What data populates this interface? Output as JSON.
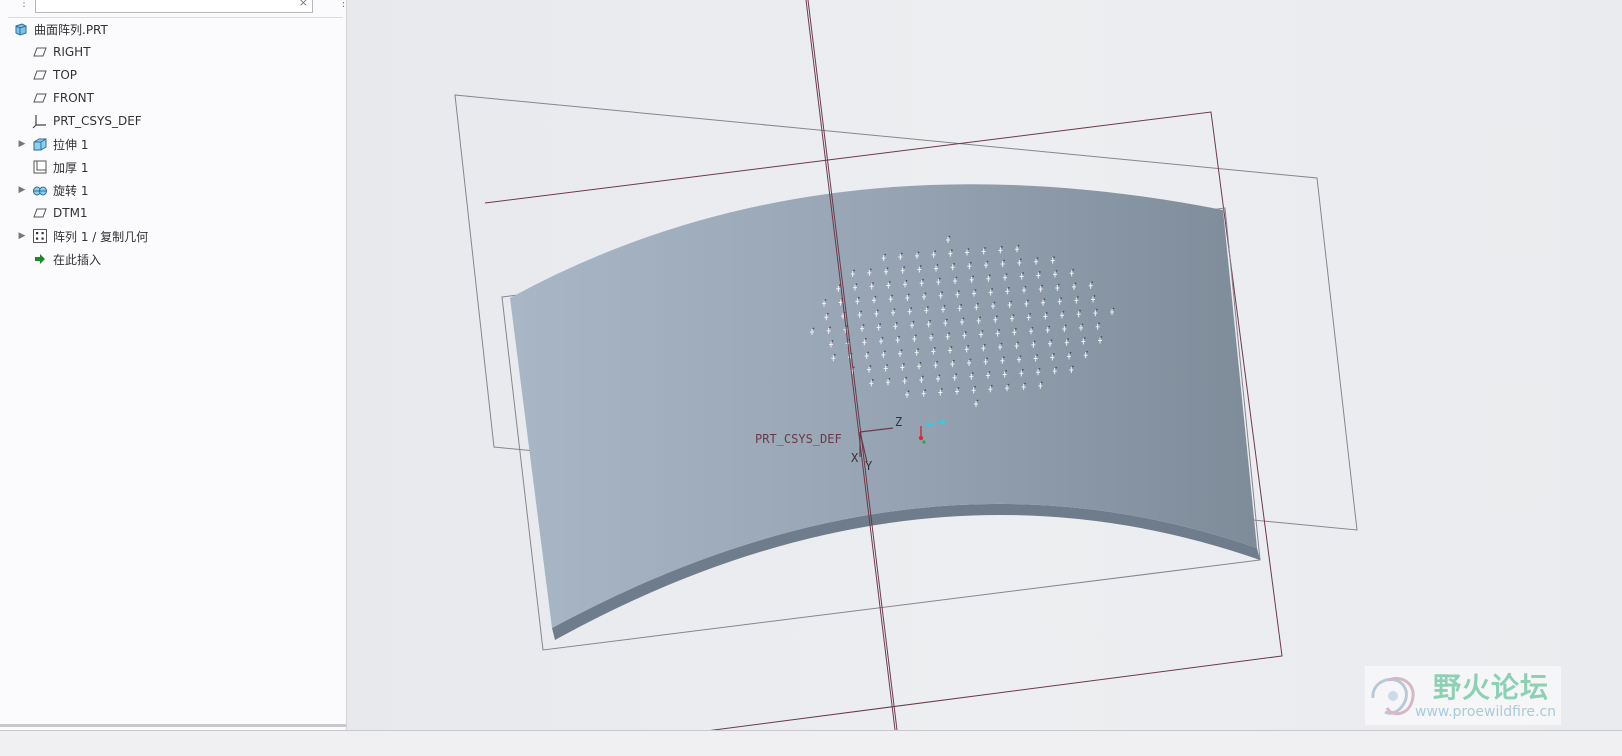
{
  "model_tree": {
    "search": {
      "value": "",
      "clear_glyph": "×"
    },
    "items": [
      {
        "label": "曲面阵列.PRT",
        "icon": "part-icon",
        "expandable": false
      },
      {
        "label": "RIGHT",
        "icon": "datum-plane-icon",
        "expandable": false
      },
      {
        "label": "TOP",
        "icon": "datum-plane-icon",
        "expandable": false
      },
      {
        "label": "FRONT",
        "icon": "datum-plane-icon",
        "expandable": false
      },
      {
        "label": "PRT_CSYS_DEF",
        "icon": "coordinate-system-icon",
        "expandable": false
      },
      {
        "label": "拉伸 1",
        "icon": "extrude-icon",
        "expandable": true
      },
      {
        "label": "加厚 1",
        "icon": "thicken-icon",
        "expandable": false
      },
      {
        "label": "旋转 1",
        "icon": "revolve-icon",
        "expandable": true
      },
      {
        "label": "DTM1",
        "icon": "datum-plane-icon",
        "expandable": false
      },
      {
        "label": "阵列 1 / 复制几何",
        "icon": "pattern-icon",
        "expandable": true
      },
      {
        "label": "在此插入",
        "icon": "insert-here-arrow-icon",
        "expandable": false
      }
    ]
  },
  "viewport": {
    "csys_label": "PRT_CSYS_DEF",
    "axis_x": "X",
    "axis_y": "Y",
    "axis_z": "Z",
    "colors": {
      "surface_light": "#a9b6c6",
      "surface_dark": "#7e8c9a",
      "datum": "#6b3a4a",
      "plane_edge": "#8a8390"
    }
  },
  "watermark": {
    "title": "野火论坛",
    "url": "www.proewildfire.cn"
  }
}
